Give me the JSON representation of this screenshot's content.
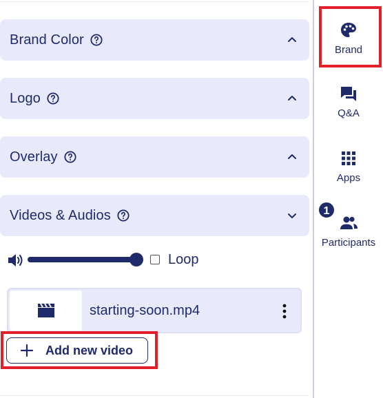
{
  "sections": [
    {
      "title": "Brand Color",
      "expanded": false
    },
    {
      "title": "Logo",
      "expanded": false
    },
    {
      "title": "Overlay",
      "expanded": false
    },
    {
      "title": "Videos & Audios",
      "expanded": true
    }
  ],
  "audio": {
    "volume": 1.0,
    "loop_label": "Loop",
    "loop_checked": false
  },
  "video": {
    "file_name": "starting-soon.mp4",
    "icon": "clapperboard-icon"
  },
  "add_video_label": "Add new video",
  "sidebar": {
    "items": [
      {
        "label": "Brand",
        "icon": "palette-icon",
        "selected": true
      },
      {
        "label": "Q&A",
        "icon": "chat-bubbles-icon"
      },
      {
        "label": "Apps",
        "icon": "grid-icon"
      },
      {
        "label": "Participants",
        "icon": "people-icon",
        "badge": "1"
      }
    ]
  },
  "colors": {
    "primary": "#1f2a6b",
    "panel": "#e8eafc",
    "highlight": "#e3202a"
  }
}
